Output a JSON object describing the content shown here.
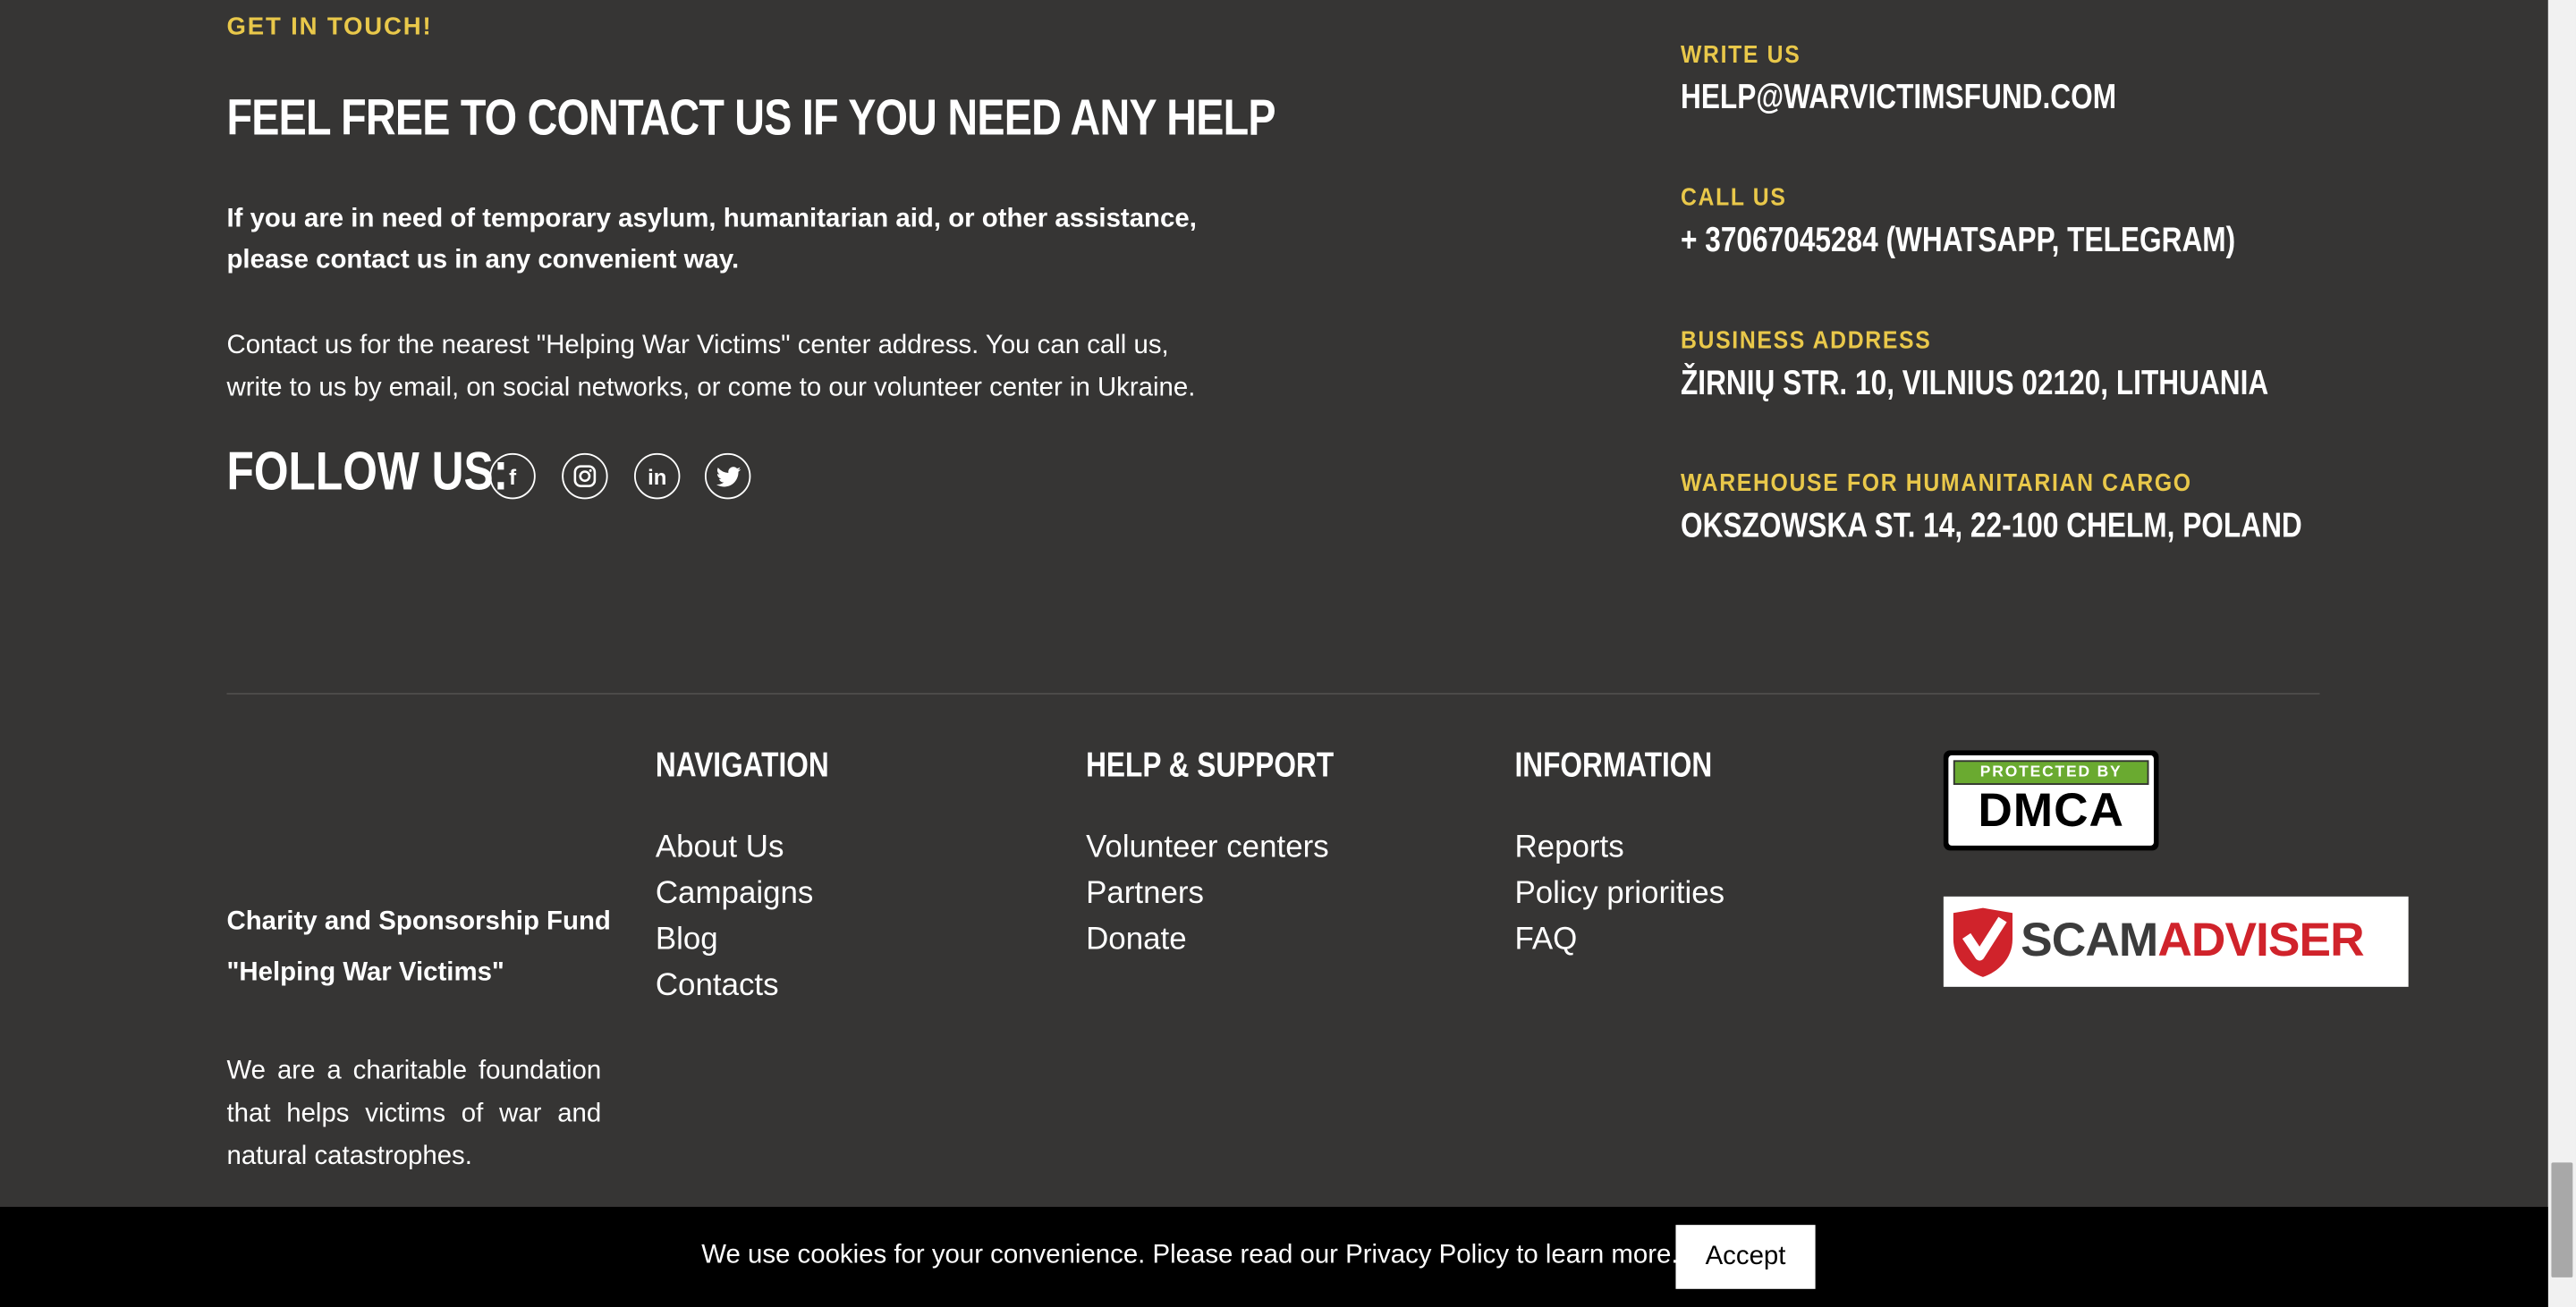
{
  "contact": {
    "eyebrow": "GET IN TOUCH!",
    "title": "FEEL FREE TO CONTACT US IF YOU NEED ANY HELP",
    "lead": "If you are in need of temporary asylum, humanitarian aid, or other assistance, please contact us in any convenient way.",
    "body": "Contact us for the nearest \"Helping War Victims\" center address. You can call us, write to us by email, on social networks, or come to our volunteer center in Ukraine.",
    "follow_label": "FOLLOW US:",
    "social": [
      {
        "icon": "facebook-icon",
        "glyph": "f"
      },
      {
        "icon": "instagram-icon",
        "glyph": "◎"
      },
      {
        "icon": "linkedin-icon",
        "glyph": "in"
      },
      {
        "icon": "twitter-icon",
        "glyph": "🐦"
      }
    ],
    "info": [
      {
        "label": "WRITE US",
        "value": "HELP@WARVICTIMSFUND.COM"
      },
      {
        "label": "CALL US",
        "value": "+ 37067045284 (WHATSAPP, TELEGRAM)"
      },
      {
        "label": "BUSINESS ADDRESS",
        "value": "ŽIRNIŲ STR. 10, VILNIUS 02120, LITHUANIA"
      },
      {
        "label": "WAREHOUSE FOR HUMANITARIAN CARGO",
        "value": "OKSZOWSKA ST. 14, 22-100 CHELM, POLAND"
      }
    ]
  },
  "footer": {
    "org_name": "Charity and Sponsorship Fund \"Helping War Victims\"",
    "org_desc": "We are a charitable foundation that helps victims of war and natural catastrophes.",
    "navigation": {
      "heading": "NAVIGATION",
      "links": [
        "About Us",
        "Campaigns",
        "Blog",
        "Contacts"
      ]
    },
    "help_support": {
      "heading": "HELP & SUPPORT",
      "links": [
        "Volunteer centers",
        "Partners",
        "Donate"
      ]
    },
    "information": {
      "heading": "INFORMATION",
      "links": [
        "Reports",
        "Policy priorities",
        "FAQ"
      ]
    },
    "dmca": {
      "top": "PROTECTED BY",
      "bottom": "DMCA"
    },
    "scamadviser": {
      "part1": "SCAM",
      "part2": "ADVISER"
    }
  },
  "cookie": {
    "text": "We use cookies for your convenience. Please read our Privacy Policy to learn more.",
    "accept_label": "Accept"
  },
  "colors": {
    "background": "#363534",
    "accent": "#e9c84a",
    "cookie_bar": "#000000"
  }
}
